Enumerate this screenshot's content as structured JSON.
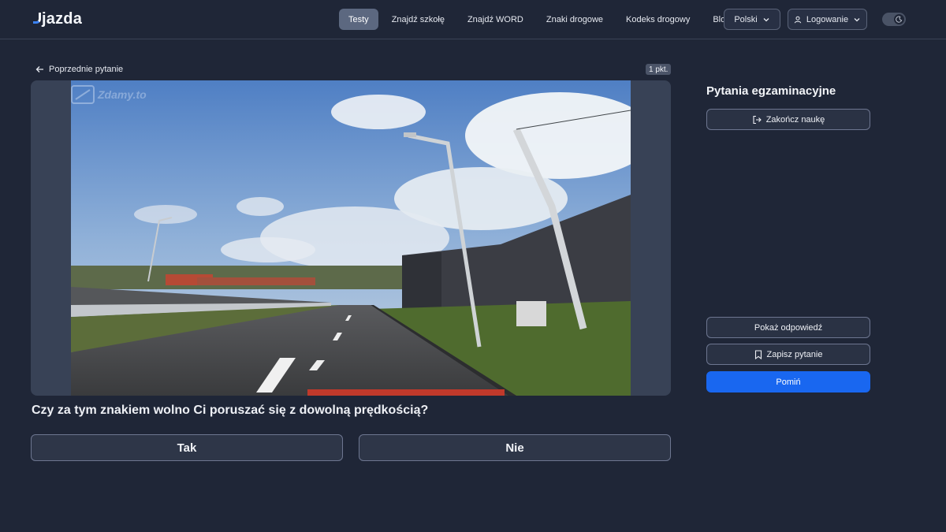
{
  "brand": {
    "name": "jazda",
    "accent": "#3b82f6"
  },
  "nav": {
    "items": [
      {
        "label": "Testy",
        "active": true
      },
      {
        "label": "Znajdź szkołę",
        "active": false
      },
      {
        "label": "Znajdź WORD",
        "active": false
      },
      {
        "label": "Znaki drogowe",
        "active": false
      },
      {
        "label": "Kodeks drogowy",
        "active": false
      },
      {
        "label": "Blog",
        "active": false
      }
    ],
    "language": "Polski",
    "login": "Logowanie",
    "theme_toggle_icon": "moon-icon"
  },
  "question": {
    "prev_label": "Poprzednie pytanie",
    "points": "1 pkt.",
    "watermark": "Zdamy.to",
    "text": "Czy za tym znakiem wolno Ci poruszać się z dowolną prędkością?",
    "answers": {
      "yes": "Tak",
      "no": "Nie"
    }
  },
  "sidebar": {
    "title": "Pytania egzaminacyjne",
    "finish_label": "Zakończ naukę",
    "show_answer_label": "Pokaż odpowiedź",
    "save_label": "Zapisz pytanie",
    "skip_label": "Pomiń",
    "skip_color": "#1967f0"
  }
}
